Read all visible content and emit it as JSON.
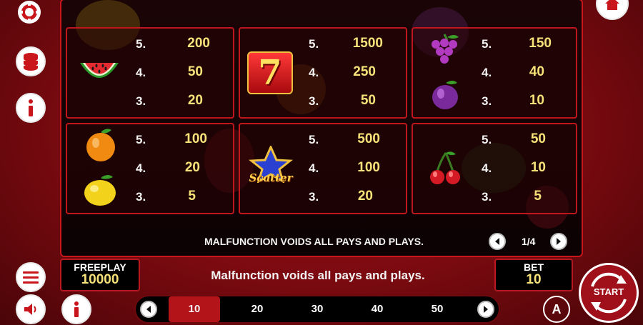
{
  "paytable": {
    "cards": [
      {
        "name": "watermelon",
        "rows": [
          {
            "count": "5.",
            "value": "200"
          },
          {
            "count": "4.",
            "value": "50"
          },
          {
            "count": "3.",
            "value": "20"
          }
        ]
      },
      {
        "name": "seven",
        "rows": [
          {
            "count": "5.",
            "value": "1500"
          },
          {
            "count": "4.",
            "value": "250"
          },
          {
            "count": "3.",
            "value": "50"
          }
        ]
      },
      {
        "name": "grapes-plum",
        "rows": [
          {
            "count": "5.",
            "value": "150"
          },
          {
            "count": "4.",
            "value": "40"
          },
          {
            "count": "3.",
            "value": "10"
          }
        ]
      },
      {
        "name": "orange-lemon",
        "rows": [
          {
            "count": "5.",
            "value": "100"
          },
          {
            "count": "4.",
            "value": "20"
          },
          {
            "count": "3.",
            "value": "5"
          }
        ]
      },
      {
        "name": "scatter",
        "rows": [
          {
            "count": "5.",
            "value": "500"
          },
          {
            "count": "4.",
            "value": "100"
          },
          {
            "count": "3.",
            "value": "20"
          }
        ]
      },
      {
        "name": "cherry",
        "rows": [
          {
            "count": "5.",
            "value": "50"
          },
          {
            "count": "4.",
            "value": "10"
          },
          {
            "count": "3.",
            "value": "5"
          }
        ]
      }
    ],
    "seven_glyph": "7",
    "scatter_label": "Scatter",
    "disclaimer": "MALFUNCTION VOIDS ALL PAYS AND PLAYS.",
    "page": "1/4"
  },
  "bottom": {
    "freeplay_label": "FREEPLAY",
    "freeplay_value": "10000",
    "message": "Malfunction voids all pays and plays.",
    "bet_label": "BET",
    "bet_value": "10",
    "bet_options": [
      "10",
      "20",
      "30",
      "40",
      "50"
    ],
    "selected_bet": "10",
    "start_label": "START",
    "auto_label": "A"
  },
  "colors": {
    "accent": "#c8161c",
    "value": "#f7e27a",
    "panel": "#120304"
  },
  "icons": [
    "gear-icon",
    "coins-icon",
    "info-icon",
    "home-icon",
    "menu-icon",
    "sound-icon",
    "info-icon",
    "chevron-left-icon",
    "chevron-right-icon",
    "autoplay-icon",
    "start-icon"
  ]
}
